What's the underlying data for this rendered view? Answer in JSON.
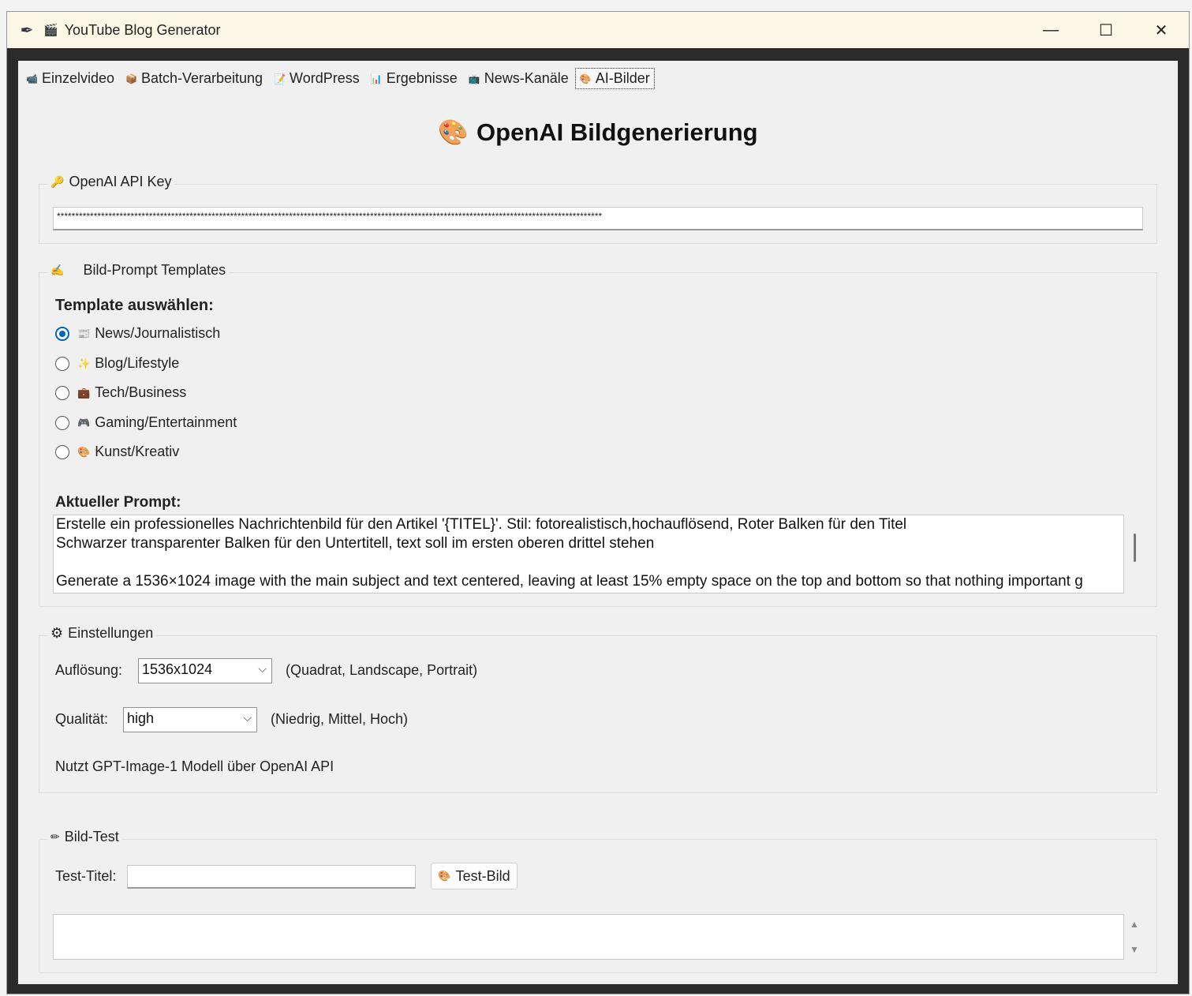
{
  "window": {
    "title": "YouTube Blog Generator",
    "title_icon": "🎬",
    "app_icon": "feather-icon",
    "minimize": "—",
    "maximize": "☐",
    "close": "✕"
  },
  "tabs": [
    {
      "icon": "📹",
      "label": "Einzelvideo"
    },
    {
      "icon": "📦",
      "label": "Batch-Verarbeitung"
    },
    {
      "icon": "📝",
      "label": "WordPress"
    },
    {
      "icon": "📊",
      "label": "Ergebnisse"
    },
    {
      "icon": "📺",
      "label": "News-Kanäle"
    },
    {
      "icon": "🎨",
      "label": "AI-Bilder",
      "active": true
    }
  ],
  "heading": {
    "icon": "🎨",
    "text": "OpenAI Bildgenerierung"
  },
  "api_key": {
    "group_label": "OpenAI API Key",
    "icon": "🔑",
    "value": "****************************************************************************************************************************************************"
  },
  "templates": {
    "group_label": "Bild-Prompt Templates",
    "icon": "✍",
    "select_label": "Template auswählen:",
    "options": [
      {
        "icon": "📰",
        "label": "News/Journalistisch",
        "checked": true
      },
      {
        "icon": "✨",
        "label": "Blog/Lifestyle",
        "checked": false
      },
      {
        "icon": "💼",
        "label": "Tech/Business",
        "checked": false
      },
      {
        "icon": "🎮",
        "label": "Gaming/Entertainment",
        "checked": false
      },
      {
        "icon": "🎨",
        "label": "Kunst/Kreativ",
        "checked": false
      }
    ],
    "prompt_label": "Aktueller Prompt:",
    "prompt_lines": [
      "Erstelle ein professionelles Nachrichtenbild für den Artikel '{TITEL}'. Stil: fotorealistisch,hochauflösend, Roter Balken für den Titel",
      "Schwarzer transparenter Balken für den Untertitell, text soll im ersten oberen drittel stehen",
      "",
      "Generate a 1536×1024 image with the main subject and text centered, leaving at least 15% empty space on the top and bottom so that nothing important g"
    ]
  },
  "settings": {
    "group_label": "Einstellungen",
    "icon": "⚙",
    "resolution_label": "Auflösung:",
    "resolution_value": "1536x1024",
    "resolution_hint": "(Quadrat, Landscape, Portrait)",
    "quality_label": "Qualität:",
    "quality_value": "high",
    "quality_hint": "(Niedrig, Mittel, Hoch)",
    "model_note": "Nutzt GPT-Image-1 Modell über OpenAI API"
  },
  "test": {
    "group_label": "Bild-Test",
    "icon": "✏",
    "title_label": "Test-Titel:",
    "title_value": "",
    "button_icon": "🎨",
    "button_label": "Test-Bild",
    "output": ""
  }
}
